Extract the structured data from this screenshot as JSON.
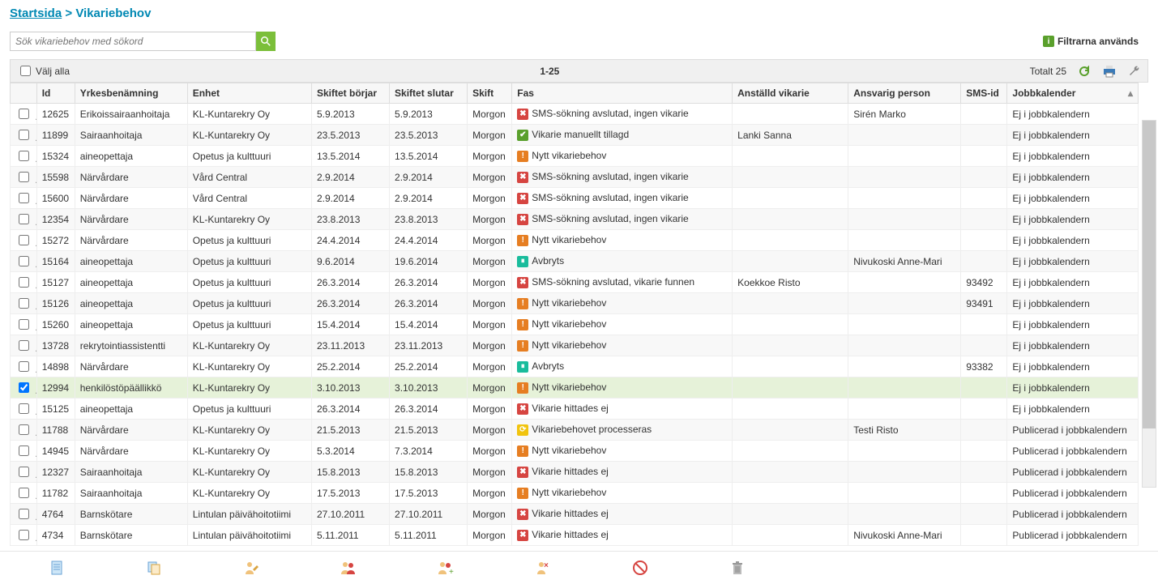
{
  "breadcrumb": {
    "home": "Startsida",
    "sep": ">",
    "current": "Vikariebehov"
  },
  "search": {
    "placeholder": "Sök vikariebehov med sökord"
  },
  "filters_used": "Filtrarna används",
  "list_header": {
    "select_all": "Välj alla",
    "range": "1-25",
    "total": "Totalt 25"
  },
  "columns": {
    "id": "Id",
    "job": "Yrkesbenämning",
    "unit": "Enhet",
    "start": "Skiftet börjar",
    "end": "Skiftet slutar",
    "shift": "Skift",
    "phase": "Fas",
    "assigned": "Anställd vikarie",
    "responsible": "Ansvarig person",
    "sms": "SMS-id",
    "calendar": "Jobbkalender"
  },
  "rows": [
    {
      "id": "12625",
      "job": "Erikoissairaanhoitaja",
      "unit": "KL-Kuntarekry Oy",
      "start": "5.9.2013",
      "end": "5.9.2013",
      "shift": "Morgon",
      "phase": "SMS-sökning avslutad, ingen vikarie",
      "badge": "red",
      "assigned": "",
      "responsible": "Sirén Marko",
      "sms": "",
      "calendar": "Ej i jobbkalendern",
      "checked": false
    },
    {
      "id": "11899",
      "job": "Sairaanhoitaja",
      "unit": "KL-Kuntarekry Oy",
      "start": "23.5.2013",
      "end": "23.5.2013",
      "shift": "Morgon",
      "phase": "Vikarie manuellt tillagd",
      "badge": "green",
      "assigned": "Lanki Sanna",
      "responsible": "",
      "sms": "",
      "calendar": "Ej i jobbkalendern",
      "checked": false
    },
    {
      "id": "15324",
      "job": "aineopettaja",
      "unit": "Opetus ja kulttuuri",
      "start": "13.5.2014",
      "end": "13.5.2014",
      "shift": "Morgon",
      "phase": "Nytt vikariebehov",
      "badge": "orange",
      "assigned": "",
      "responsible": "",
      "sms": "",
      "calendar": "Ej i jobbkalendern",
      "checked": false
    },
    {
      "id": "15598",
      "job": "Närvårdare",
      "unit": "Vård Central",
      "start": "2.9.2014",
      "end": "2.9.2014",
      "shift": "Morgon",
      "phase": "SMS-sökning avslutad, ingen vikarie",
      "badge": "red",
      "assigned": "",
      "responsible": "",
      "sms": "",
      "calendar": "Ej i jobbkalendern",
      "checked": false
    },
    {
      "id": "15600",
      "job": "Närvårdare",
      "unit": "Vård Central",
      "start": "2.9.2014",
      "end": "2.9.2014",
      "shift": "Morgon",
      "phase": "SMS-sökning avslutad, ingen vikarie",
      "badge": "red",
      "assigned": "",
      "responsible": "",
      "sms": "",
      "calendar": "Ej i jobbkalendern",
      "checked": false
    },
    {
      "id": "12354",
      "job": "Närvårdare",
      "unit": "KL-Kuntarekry Oy",
      "start": "23.8.2013",
      "end": "23.8.2013",
      "shift": "Morgon",
      "phase": "SMS-sökning avslutad, ingen vikarie",
      "badge": "red",
      "assigned": "",
      "responsible": "",
      "sms": "",
      "calendar": "Ej i jobbkalendern",
      "checked": false
    },
    {
      "id": "15272",
      "job": "Närvårdare",
      "unit": "Opetus ja kulttuuri",
      "start": "24.4.2014",
      "end": "24.4.2014",
      "shift": "Morgon",
      "phase": "Nytt vikariebehov",
      "badge": "orange",
      "assigned": "",
      "responsible": "",
      "sms": "",
      "calendar": "Ej i jobbkalendern",
      "checked": false
    },
    {
      "id": "15164",
      "job": "aineopettaja",
      "unit": "Opetus ja kulttuuri",
      "start": "9.6.2014",
      "end": "19.6.2014",
      "shift": "Morgon",
      "phase": "Avbryts",
      "badge": "cyan",
      "assigned": "",
      "responsible": "Nivukoski Anne-Mari",
      "sms": "",
      "calendar": "Ej i jobbkalendern",
      "checked": false
    },
    {
      "id": "15127",
      "job": "aineopettaja",
      "unit": "Opetus ja kulttuuri",
      "start": "26.3.2014",
      "end": "26.3.2014",
      "shift": "Morgon",
      "phase": "SMS-sökning avslutad, vikarie funnen",
      "badge": "red",
      "assigned": "Koekkoe Risto",
      "responsible": "",
      "sms": "93492",
      "calendar": "Ej i jobbkalendern",
      "checked": false
    },
    {
      "id": "15126",
      "job": "aineopettaja",
      "unit": "Opetus ja kulttuuri",
      "start": "26.3.2014",
      "end": "26.3.2014",
      "shift": "Morgon",
      "phase": "Nytt vikariebehov",
      "badge": "orange",
      "assigned": "",
      "responsible": "",
      "sms": "93491",
      "calendar": "Ej i jobbkalendern",
      "checked": false
    },
    {
      "id": "15260",
      "job": "aineopettaja",
      "unit": "Opetus ja kulttuuri",
      "start": "15.4.2014",
      "end": "15.4.2014",
      "shift": "Morgon",
      "phase": "Nytt vikariebehov",
      "badge": "orange",
      "assigned": "",
      "responsible": "",
      "sms": "",
      "calendar": "Ej i jobbkalendern",
      "checked": false
    },
    {
      "id": "13728",
      "job": "rekrytointiassistentti",
      "unit": "KL-Kuntarekry Oy",
      "start": "23.11.2013",
      "end": "23.11.2013",
      "shift": "Morgon",
      "phase": "Nytt vikariebehov",
      "badge": "orange",
      "assigned": "",
      "responsible": "",
      "sms": "",
      "calendar": "Ej i jobbkalendern",
      "checked": false
    },
    {
      "id": "14898",
      "job": "Närvårdare",
      "unit": "KL-Kuntarekry Oy",
      "start": "25.2.2014",
      "end": "25.2.2014",
      "shift": "Morgon",
      "phase": "Avbryts",
      "badge": "cyan",
      "assigned": "",
      "responsible": "",
      "sms": "93382",
      "calendar": "Ej i jobbkalendern",
      "checked": false
    },
    {
      "id": "12994",
      "job": "henkilöstöpäällikkö",
      "unit": "KL-Kuntarekry Oy",
      "start": "3.10.2013",
      "end": "3.10.2013",
      "shift": "Morgon",
      "phase": "Nytt vikariebehov",
      "badge": "orange",
      "assigned": "",
      "responsible": "",
      "sms": "",
      "calendar": "Ej i jobbkalendern",
      "checked": true
    },
    {
      "id": "15125",
      "job": "aineopettaja",
      "unit": "Opetus ja kulttuuri",
      "start": "26.3.2014",
      "end": "26.3.2014",
      "shift": "Morgon",
      "phase": "Vikarie hittades ej",
      "badge": "red",
      "assigned": "",
      "responsible": "",
      "sms": "",
      "calendar": "Ej i jobbkalendern",
      "checked": false
    },
    {
      "id": "11788",
      "job": "Närvårdare",
      "unit": "KL-Kuntarekry Oy",
      "start": "21.5.2013",
      "end": "21.5.2013",
      "shift": "Morgon",
      "phase": "Vikariebehovet processeras",
      "badge": "yellow",
      "assigned": "",
      "responsible": "Testi Risto",
      "sms": "",
      "calendar": "Publicerad i jobbkalendern",
      "checked": false
    },
    {
      "id": "14945",
      "job": "Närvårdare",
      "unit": "KL-Kuntarekry Oy",
      "start": "5.3.2014",
      "end": "7.3.2014",
      "shift": "Morgon",
      "phase": "Nytt vikariebehov",
      "badge": "orange",
      "assigned": "",
      "responsible": "",
      "sms": "",
      "calendar": "Publicerad i jobbkalendern",
      "checked": false
    },
    {
      "id": "12327",
      "job": "Sairaanhoitaja",
      "unit": "KL-Kuntarekry Oy",
      "start": "15.8.2013",
      "end": "15.8.2013",
      "shift": "Morgon",
      "phase": "Vikarie hittades ej",
      "badge": "red",
      "assigned": "",
      "responsible": "",
      "sms": "",
      "calendar": "Publicerad i jobbkalendern",
      "checked": false
    },
    {
      "id": "11782",
      "job": "Sairaanhoitaja",
      "unit": "KL-Kuntarekry Oy",
      "start": "17.5.2013",
      "end": "17.5.2013",
      "shift": "Morgon",
      "phase": "Nytt vikariebehov",
      "badge": "orange",
      "assigned": "",
      "responsible": "",
      "sms": "",
      "calendar": "Publicerad i jobbkalendern",
      "checked": false
    },
    {
      "id": "4764",
      "job": "Barnskötare",
      "unit": "Lintulan päivähoitotiimi",
      "start": "27.10.2011",
      "end": "27.10.2011",
      "shift": "Morgon",
      "phase": "Vikarie hittades ej",
      "badge": "red",
      "assigned": "",
      "responsible": "",
      "sms": "",
      "calendar": "Publicerad i jobbkalendern",
      "checked": false
    },
    {
      "id": "4734",
      "job": "Barnskötare",
      "unit": "Lintulan päivähoitotiimi",
      "start": "5.11.2011",
      "end": "5.11.2011",
      "shift": "Morgon",
      "phase": "Vikarie hittades ej",
      "badge": "red",
      "assigned": "",
      "responsible": "Nivukoski Anne-Mari",
      "sms": "",
      "calendar": "Publicerad i jobbkalendern",
      "checked": false
    }
  ],
  "footer_icons": [
    "document-icon",
    "copy-icon",
    "person-edit-icon",
    "people-icon",
    "people-add-icon",
    "person-remove-icon",
    "forbidden-icon",
    "trash-icon"
  ]
}
